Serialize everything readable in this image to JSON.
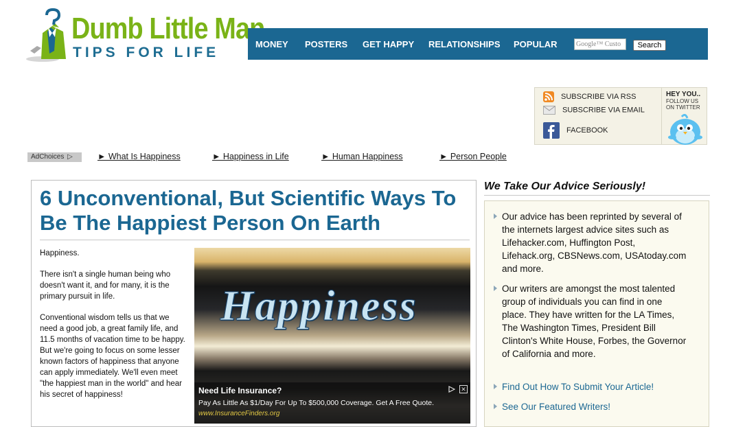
{
  "logo": {
    "title": "Dumb Little Man",
    "tagline": "TIPS FOR LIFE"
  },
  "nav": {
    "items": [
      "MONEY",
      "POSTERS",
      "GET HAPPY",
      "RELATIONSHIPS",
      "POPULAR"
    ],
    "search_placeholder": "Google™ Custo",
    "search_button": "Search"
  },
  "subscribe": {
    "rss": "SUBSCRIBE VIA RSS",
    "email": "SUBSCRIBE VIA EMAIL",
    "facebook": "FACEBOOK",
    "twitter_title": "HEY YOU..",
    "twitter_sub": "FOLLOW US ON TWITTER"
  },
  "ads": {
    "adchoices": "AdChoices",
    "links": [
      "► What Is Happiness",
      "► Happiness in Life",
      "► Human Happiness",
      "► Person People"
    ]
  },
  "article": {
    "headline": "6 Unconventional, But Scientific Ways To Be The Happiest Person On Earth",
    "paragraphs": [
      "Happiness.",
      "There isn't a single human being who doesn't want it, and for many, it is the primary pursuit in life.",
      "Conventional wisdom tells us that we need a good job, a great family life, and 11.5 months of vacation time to be happy. But we're going to focus on some lesser known factors of happiness that anyone can apply immediately. We'll even meet \"the happiest man in the world\" and hear his secret of happiness!"
    ],
    "image_word": "Happiness",
    "ad": {
      "title": "Need Life Insurance?",
      "desc": "Pay As Little As $1/Day For Up To $500,000 Coverage. Get A Free Quote.",
      "url": "www.InsuranceFinders.org"
    }
  },
  "sidebar": {
    "title": "We Take Our Advice Seriously!",
    "items": [
      "Our advice has been reprinted by several of the internets largest advice sites such as Lifehacker.com, Huffington Post, Lifehack.org, CBSNews.com, USAtoday.com and more.",
      "Our writers are amongst the most talented group of individuals you can find in one place. They have written for the LA Times, The Washington Times, President Bill Clinton's White House, Forbes, the Governor of California and more."
    ],
    "links": [
      "Find Out How To Submit Your Article!",
      "See Our Featured Writers!"
    ]
  },
  "colors": {
    "brand_green": "#7ab317",
    "brand_blue": "#1b6792",
    "nav_bg": "#1b6792"
  }
}
